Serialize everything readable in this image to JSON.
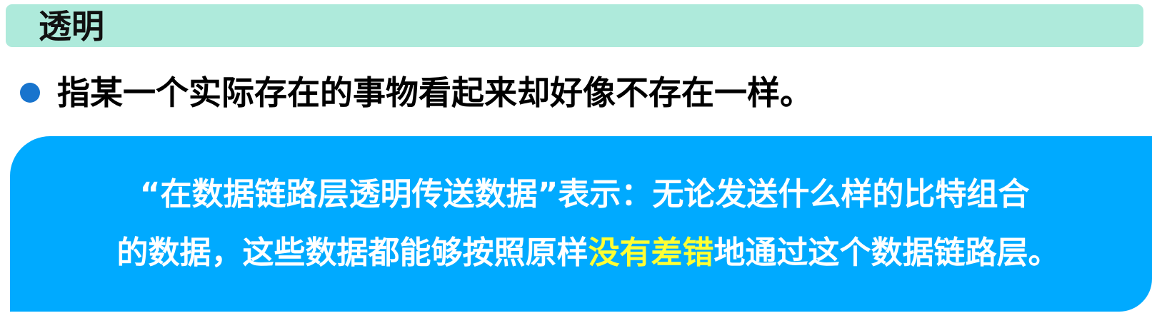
{
  "header": {
    "title": "透明"
  },
  "bullet": {
    "text": "指某一个实际存在的事物看起来却好像不存在一样。"
  },
  "note": {
    "line1": "“在数据链路层透明传送数据”表示：无论发送什么样的比特组合",
    "line2_before": "的数据，这些数据都能够按照原样",
    "line2_highlight": "没有差错",
    "line2_after": "地通过这个数据链路层。"
  },
  "colors": {
    "title_bar": "#aeeadb",
    "bullet_dot": "#1874cd",
    "note_box": "#00aaff",
    "note_text": "#ffffff",
    "highlight_text": "#ffff33"
  }
}
